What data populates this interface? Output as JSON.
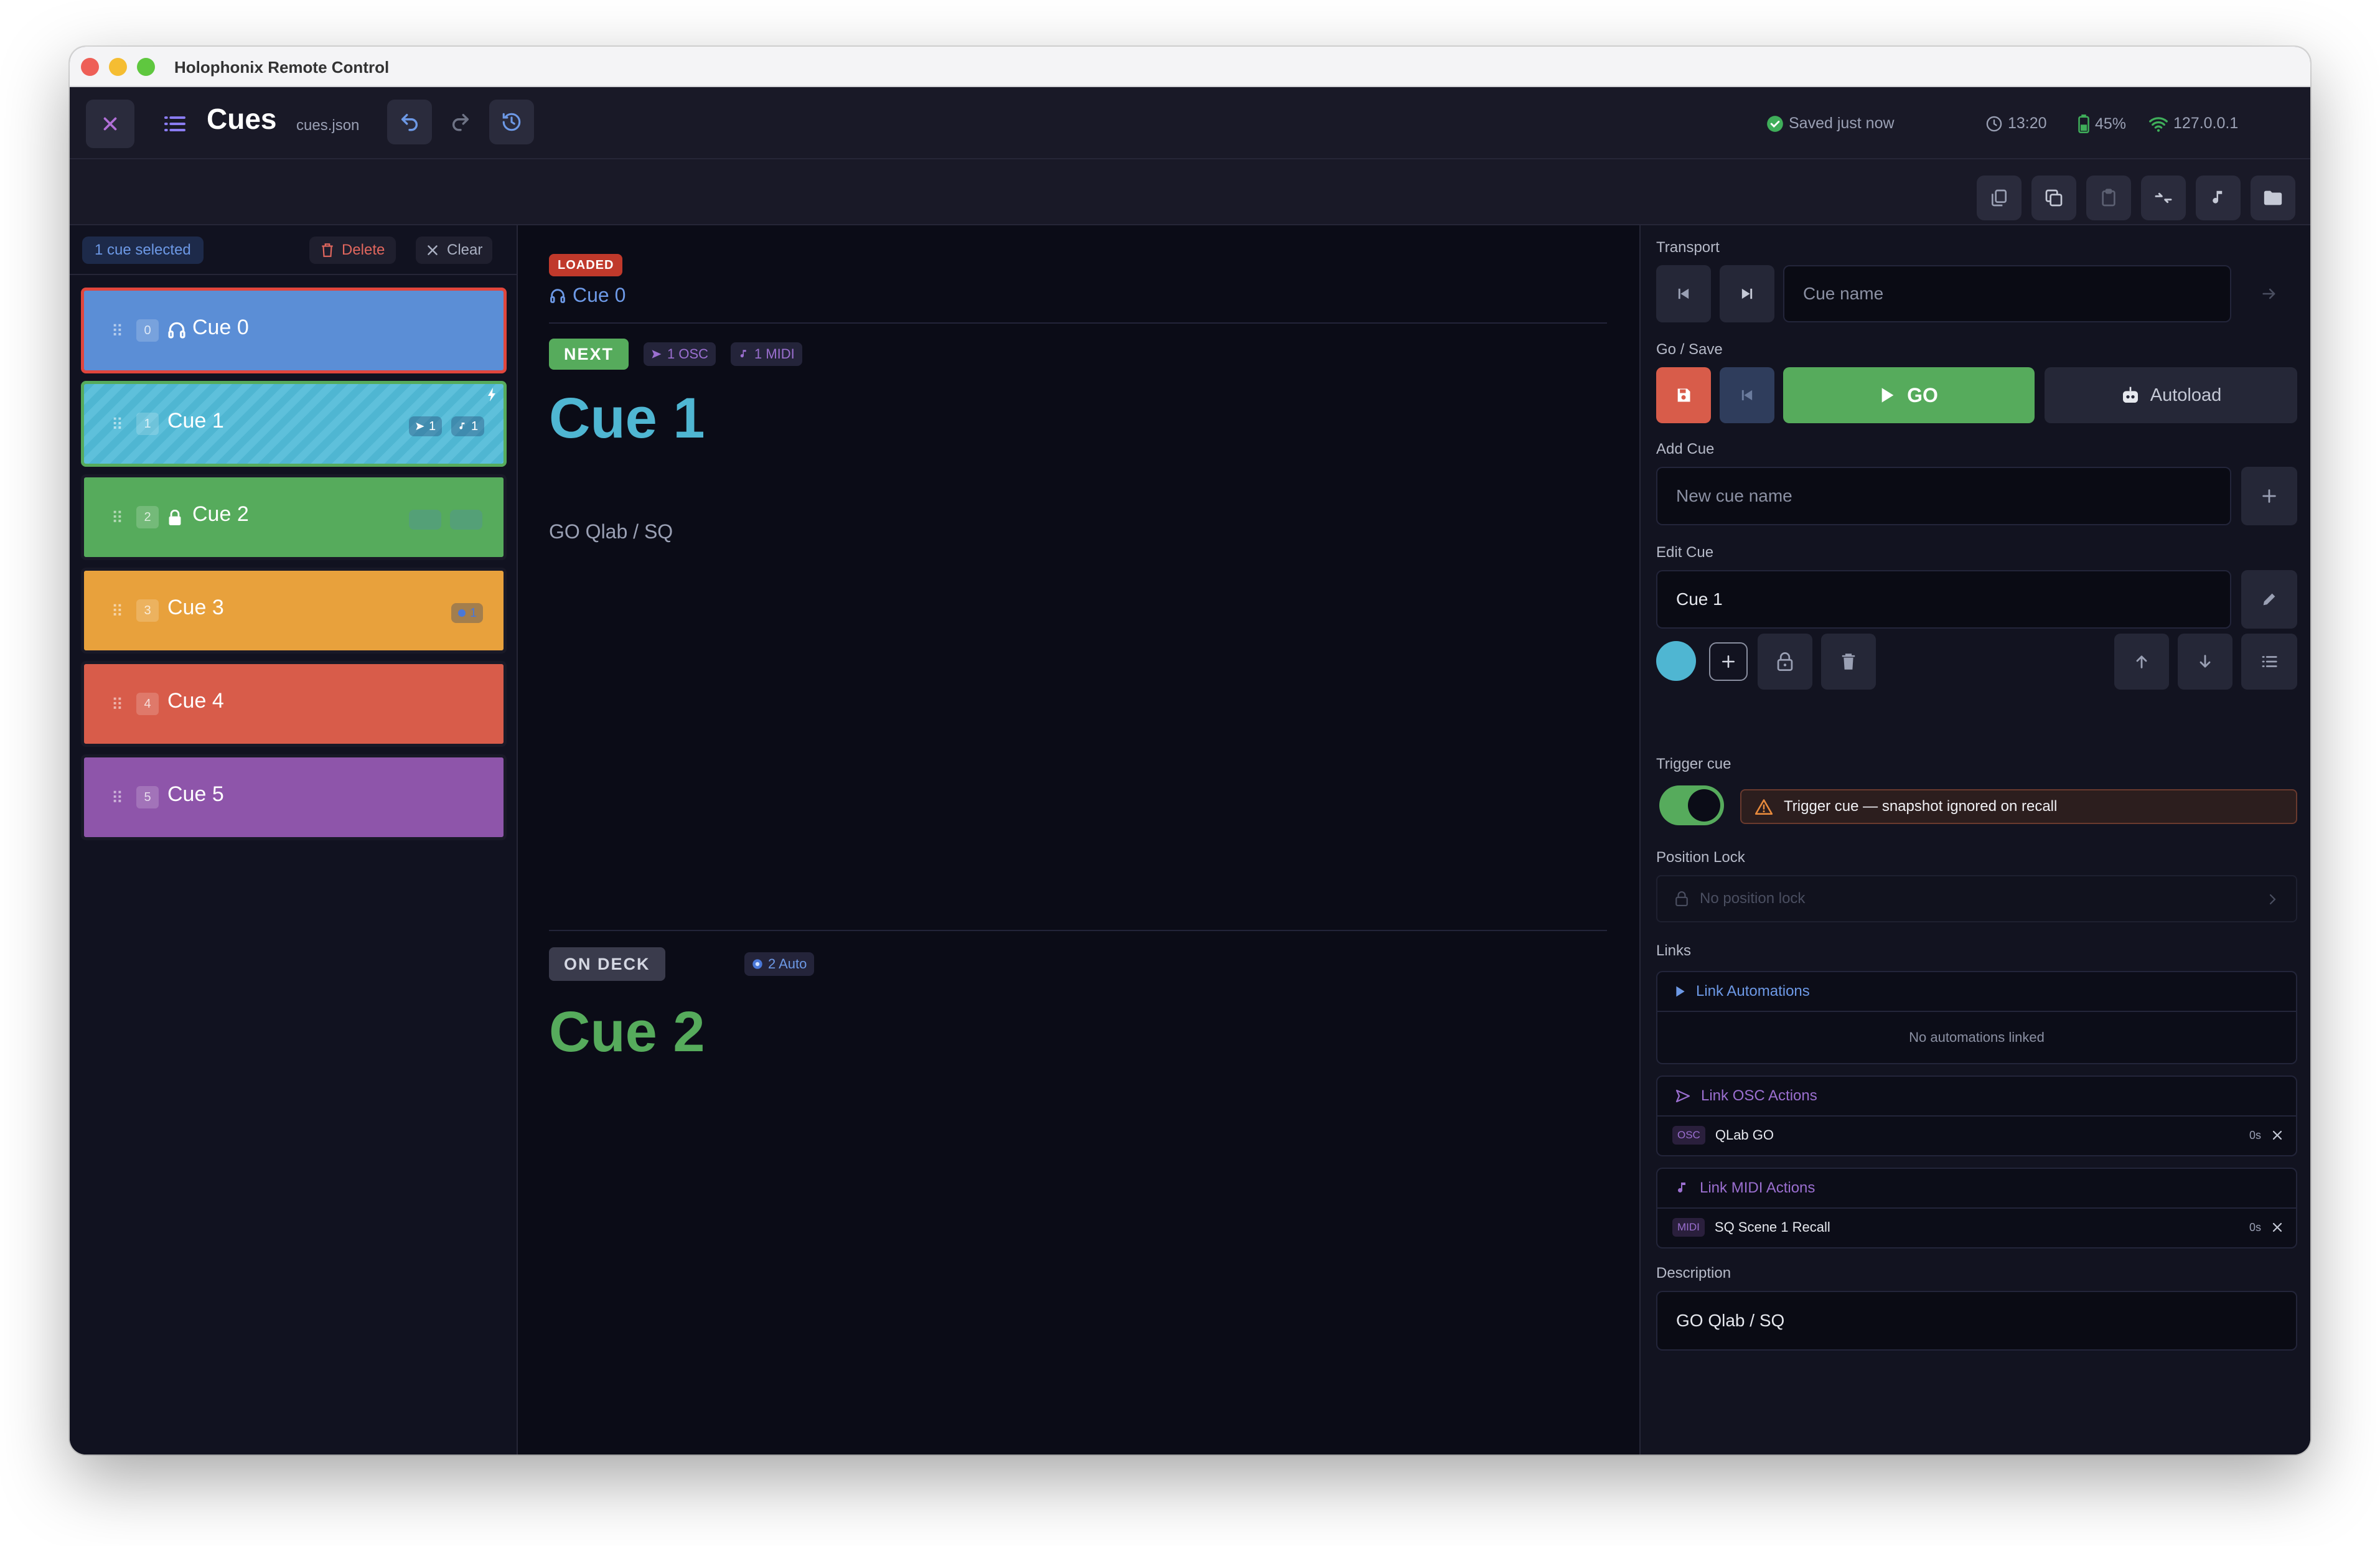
{
  "window": {
    "title": "Holophonix Remote Control"
  },
  "header": {
    "title": "Cues",
    "file": "cues.json",
    "saved": "Saved just now",
    "time": "13:20",
    "battery": "45%",
    "network": "127.0.0.1"
  },
  "selection": {
    "badge": "1 cue selected",
    "delete_label": "Delete",
    "clear_label": "Clear"
  },
  "cues": [
    {
      "index": "0",
      "name": "Cue 0",
      "color": "#5b8ed6"
    },
    {
      "index": "1",
      "name": "Cue 1",
      "color": "#4fb6d2",
      "osc": "1",
      "midi": "1"
    },
    {
      "index": "2",
      "name": "Cue 2",
      "color": "#56ab5c"
    },
    {
      "index": "3",
      "name": "Cue 3",
      "color": "#e8a13c",
      "auto": "1"
    },
    {
      "index": "4",
      "name": "Cue 4",
      "color": "#d85c4a"
    },
    {
      "index": "5",
      "name": "Cue 5",
      "color": "#8e55aa"
    }
  ],
  "center": {
    "loaded_badge": "LOADED",
    "loaded_name": "Cue 0",
    "next_badge": "NEXT",
    "next_osc": "1 OSC",
    "next_midi": "1 MIDI",
    "next_name": "Cue 1",
    "next_description": "GO Qlab / SQ",
    "ondeck_badge": "ON DECK",
    "ondeck_auto": "2 Auto",
    "ondeck_name": "Cue 2"
  },
  "panel": {
    "transport_label": "Transport",
    "transport_placeholder": "Cue name",
    "gosave_label": "Go / Save",
    "go_label": "GO",
    "autoload_label": "Autoload",
    "addcue_label": "Add Cue",
    "addcue_placeholder": "New cue name",
    "editcue_label": "Edit Cue",
    "editcue_value": "Cue 1",
    "trigger_label": "Trigger cue",
    "trigger_warning": "Trigger cue — snapshot ignored on recall",
    "poslock_label": "Position Lock",
    "poslock_value": "No position lock",
    "links_label": "Links",
    "link_automations": "Link Automations",
    "no_automations": "No automations linked",
    "link_osc": "Link OSC Actions",
    "osc_tag": "OSC",
    "osc_action": "QLab GO",
    "osc_delay": "0s",
    "link_midi": "Link MIDI Actions",
    "midi_tag": "MIDI",
    "midi_action": "SQ Scene 1 Recall",
    "midi_delay": "0s",
    "description_label": "Description",
    "description_value": "GO Qlab / SQ"
  },
  "colors": {
    "accent_blue": "#4fb6d2",
    "go_green": "#56ab5c",
    "save_red": "#d85c4a",
    "loaded_red": "#c0392b",
    "purple": "#9b6fd0"
  }
}
